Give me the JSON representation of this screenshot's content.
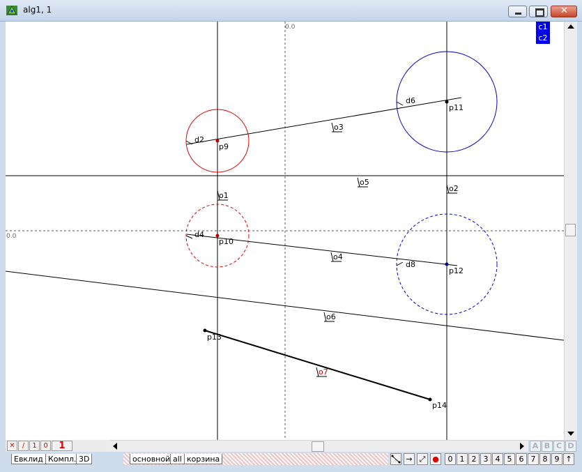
{
  "window": {
    "title": "alg1, 1"
  },
  "legend": {
    "items": [
      "c1",
      "c2"
    ]
  },
  "axes": {
    "top_label": "0.0",
    "left_label": "0.0"
  },
  "labels": {
    "p9": "p9",
    "p10": "p10",
    "p11": "p11",
    "p12": "p12",
    "p13": "p13",
    "p14": "p14",
    "d2": "d2",
    "d4": "d4",
    "d6": "d6",
    "d8": "d8",
    "o1": "o1",
    "o2": "o2",
    "o3": "o3",
    "o4": "o4",
    "o5": "o5",
    "o6": "o6",
    "o7": "o7"
  },
  "toolbar": {
    "btn1": "1",
    "btn0": "0",
    "big1": "1"
  },
  "layer_buttons": [
    "A",
    "B",
    "C",
    "D"
  ],
  "left_tabs": [
    "Евклид",
    "Компл.",
    "3D"
  ],
  "mid_tabs": [
    "основной",
    "all",
    "корзина"
  ],
  "num_buttons": [
    "0",
    "1",
    "2",
    "3",
    "4",
    "5",
    "6",
    "7",
    "8",
    "9"
  ],
  "colors": {
    "red": "#e00000",
    "blue": "#0000cc",
    "legend_bg": "#0000ee"
  }
}
